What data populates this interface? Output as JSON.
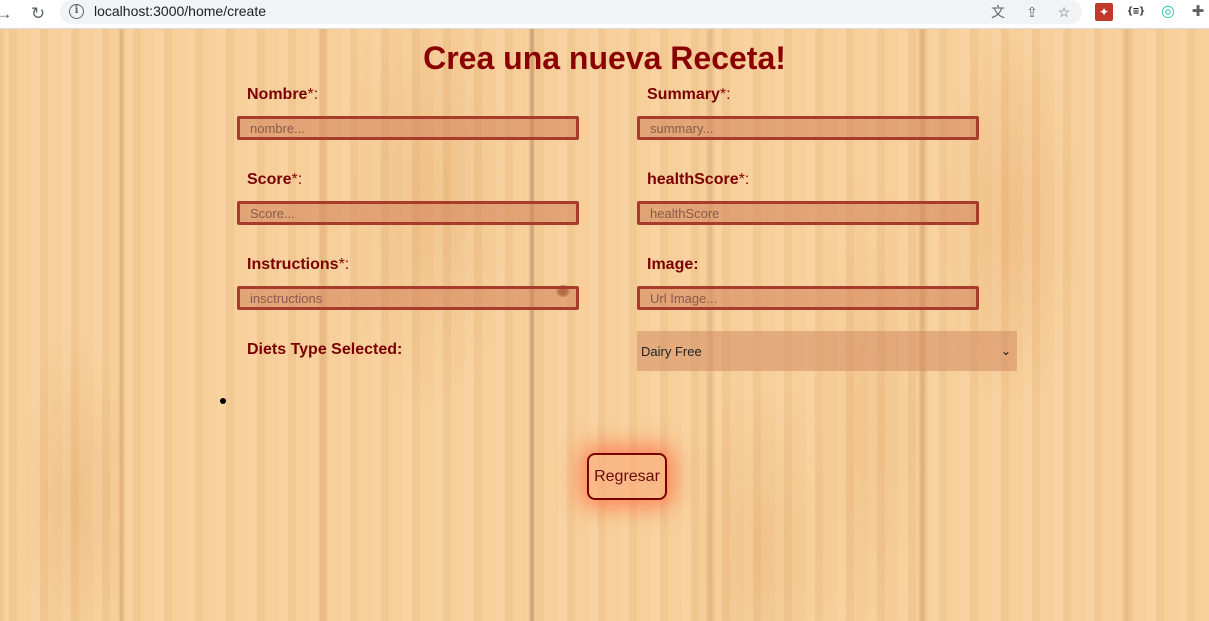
{
  "browser": {
    "url": "localhost:3000/home/create"
  },
  "form": {
    "title": "Crea una nueva Receta!",
    "fields": {
      "nombre": {
        "label": "Nombre",
        "required_mark": "*:",
        "placeholder": "nombre..."
      },
      "summary": {
        "label": "Summary",
        "required_mark": "*:",
        "placeholder": "summary..."
      },
      "score": {
        "label": "Score",
        "required_mark": "*:",
        "placeholder": "Score..."
      },
      "healthScore": {
        "label": "healthScore",
        "required_mark": "*:",
        "placeholder": "healthScore"
      },
      "instructions": {
        "label": "Instructions",
        "required_mark": "*:",
        "placeholder": "insctructions"
      },
      "image": {
        "label": "Image:",
        "placeholder": "Url Image..."
      }
    },
    "diets": {
      "label": "Diets Type Selected:",
      "selected": "Dairy Free"
    },
    "back_button": "Regresar"
  },
  "colors": {
    "title": "#8b0000",
    "label": "#7a0000",
    "field_border": "#a83c2c",
    "wood": "#f6cd98"
  }
}
